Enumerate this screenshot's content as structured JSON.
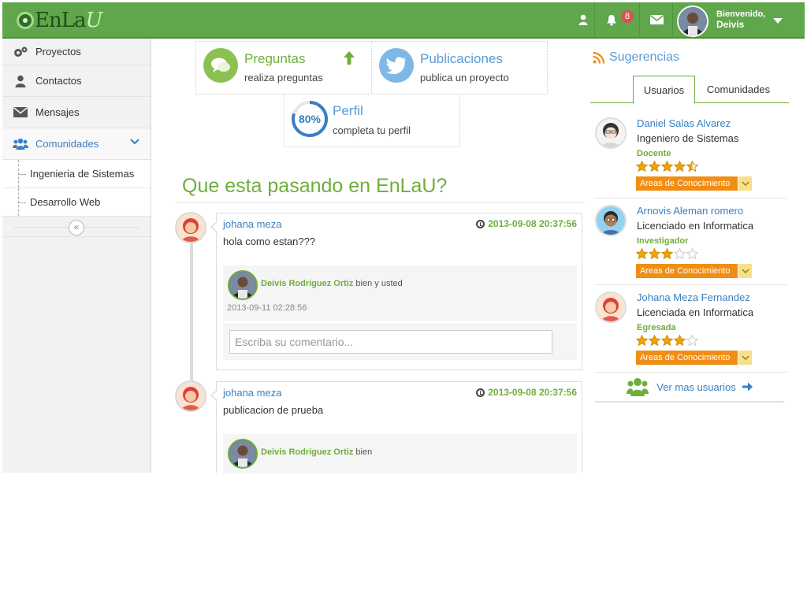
{
  "header": {
    "logo_e": "En",
    "logo_la": "La",
    "logo_u": "U",
    "notifications_count": "8",
    "welcome_label": "Bienvenido,",
    "user_name": "Deivis",
    "icons": [
      "user-icon",
      "bell-icon",
      "envelope-icon",
      "chevron-down-icon"
    ],
    "colors": {
      "bar": "#5fa74a",
      "badge": "#d9534f"
    }
  },
  "sidebar": {
    "items": [
      {
        "label": "Proyectos",
        "icon": "gears-icon"
      },
      {
        "label": "Contactos",
        "icon": "user-icon"
      },
      {
        "label": "Mensajes",
        "icon": "envelope-icon"
      },
      {
        "label": "Comunidades",
        "icon": "users-icon"
      }
    ],
    "subitems": [
      {
        "label": "Ingenieria de Sistemas"
      },
      {
        "label": "Desarrollo Web"
      }
    ],
    "collapse_icon": "«"
  },
  "info_boxes": {
    "preguntas": {
      "title": "Preguntas",
      "subtitle": "realiza preguntas"
    },
    "publicaciones": {
      "title": "Publicaciones",
      "subtitle": "publica un proyecto"
    },
    "perfil": {
      "title": "Perfil",
      "subtitle": "completa tu perfil",
      "percent_label": "80%",
      "progress": 0.8
    }
  },
  "feed": {
    "title": "Que esta pasando en EnLaU?",
    "posts": [
      {
        "author": "johana meza",
        "date": "2013-09-08 20:37:56",
        "text": "hola como estan???",
        "comment": {
          "author": "Deivis Rodriguez Ortiz",
          "text": "bien y usted",
          "date": "2013-09-11 02:28:56"
        },
        "input_placeholder": "Escriba su comentario..."
      },
      {
        "author": "johana meza",
        "date": "2013-09-08 20:37:56",
        "text": "publicacion de prueba",
        "comment": {
          "author": "Deivis Rodriguez Ortiz",
          "text": "bien"
        }
      }
    ]
  },
  "suggestions": {
    "title": "Sugerencias",
    "tabs": [
      "Usuarios",
      "Comunidades"
    ],
    "users": [
      {
        "name": "Daniel Salas Alvarez",
        "job": "Ingeniero de Sistemas",
        "role": "Docente",
        "rating": 4.5,
        "areas_label": "Areas de Conocimiento"
      },
      {
        "name": "Arnovis Aleman romero",
        "job": "Licenciado en Informatica",
        "role": "Investigador",
        "rating": 3,
        "areas_label": "Areas de Conocimiento"
      },
      {
        "name": "Johana Meza Fernandez",
        "job": "Licenciada en Informatica",
        "role": "Egresada",
        "rating": 4,
        "areas_label": "Areas de Conocimiento"
      }
    ],
    "more_label": "Ver mas usuarios"
  }
}
